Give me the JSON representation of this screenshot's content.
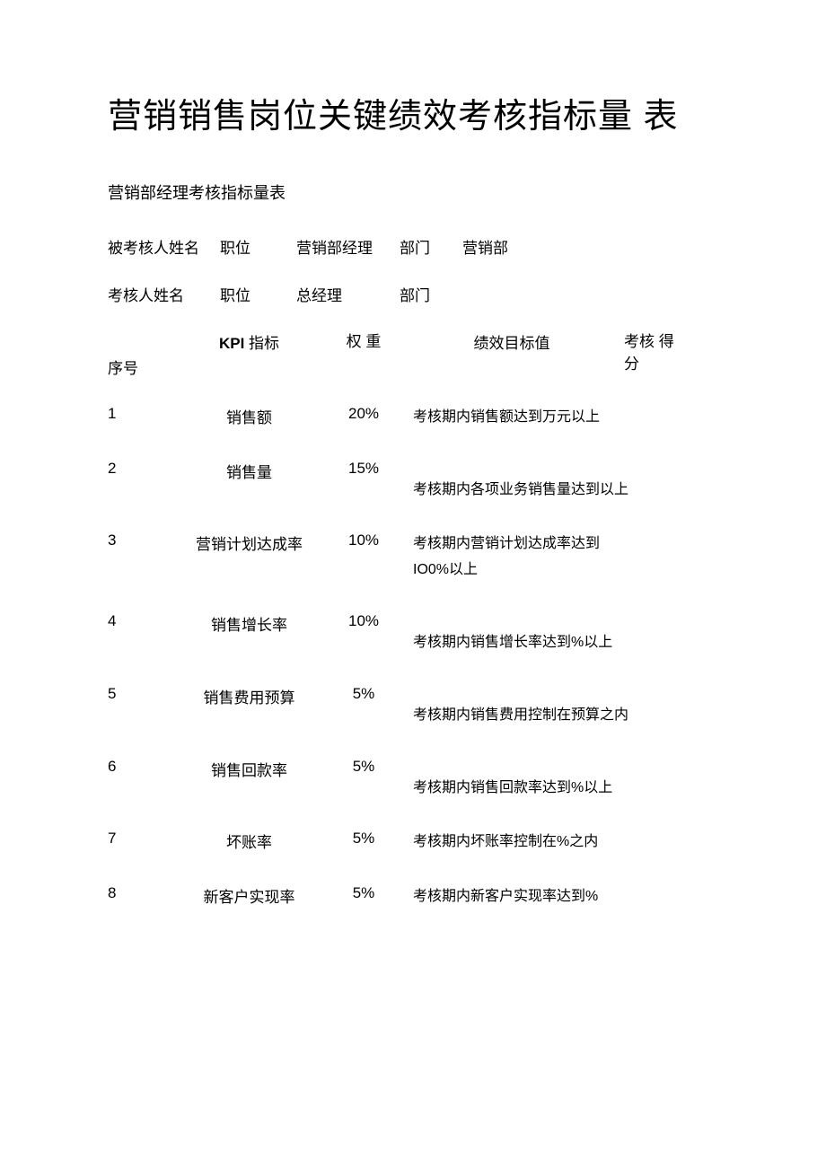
{
  "title": "营销销售岗位关键绩效考核指标量 表",
  "subtitle": "营销部经理考核指标量表",
  "info": {
    "assessee_name_label": "被考核人姓名",
    "assessee_name_value": "",
    "position_label": "职位",
    "assessee_position": "营销部经理",
    "department_label": "部门",
    "assessee_department": "营销部",
    "assessor_name_label": "考核人姓名",
    "assessor_name_value": "",
    "assessor_position": "总经理",
    "assessor_department": ""
  },
  "headers": {
    "seq": "序号",
    "kpi_prefix": "KPI",
    "kpi_suffix": " 指标",
    "weight": "权 重",
    "target": "绩效目标值",
    "score": "考核 得分"
  },
  "rows": [
    {
      "seq": "1",
      "kpi": "销售额",
      "weight": "20%",
      "target": "考核期内销售额达到万元以上",
      "offset": false
    },
    {
      "seq": "2",
      "kpi": "销售量",
      "weight": "15%",
      "target": "考核期内各项业务销售量达到以上",
      "offset": true
    },
    {
      "seq": "3",
      "kpi": "营销计划达成率",
      "weight": "10%",
      "target": "考核期内营销计划达成率达到 IO0%以上",
      "offset": false
    },
    {
      "seq": "4",
      "kpi": "销售增长率",
      "weight": "10%",
      "target": "考核期内销售增长率达到%以上",
      "offset": true
    },
    {
      "seq": "5",
      "kpi": "销售费用预算",
      "weight": "5%",
      "target": "考核期内销售费用控制在预算之内",
      "offset": true
    },
    {
      "seq": "6",
      "kpi": "销售回款率",
      "weight": "5%",
      "target": "考核期内销售回款率达到%以上",
      "offset": true
    },
    {
      "seq": "7",
      "kpi": "坏账率",
      "weight": "5%",
      "target": "考核期内坏账率控制在%之内",
      "offset": false
    },
    {
      "seq": "8",
      "kpi": "新客户实现率",
      "weight": "5%",
      "target": "考核期内新客户实现率达到%",
      "offset": false
    }
  ]
}
